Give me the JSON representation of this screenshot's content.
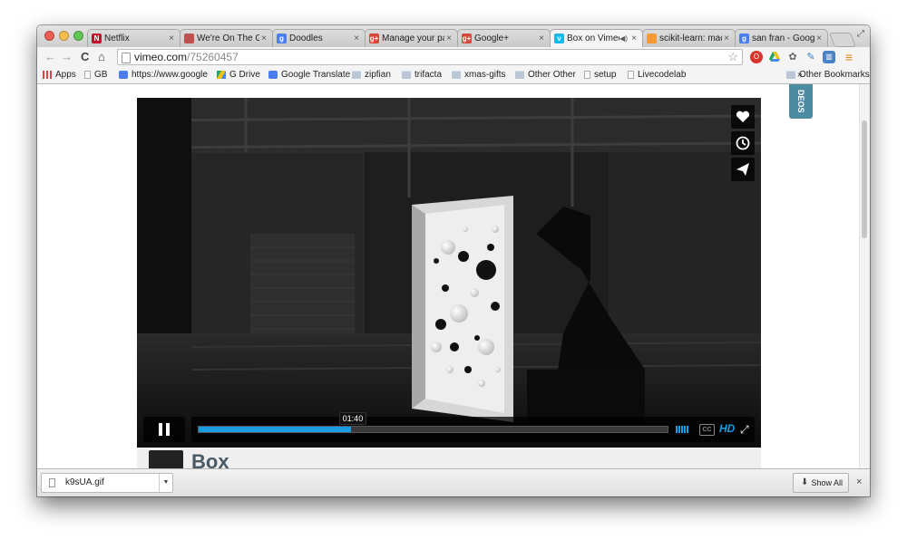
{
  "browser": {
    "tabs": [
      {
        "title": "Netflix",
        "favicon": "netflix-favicon-icon",
        "favicon_color": "#c8102e",
        "favicon_text": "N",
        "close": "×"
      },
      {
        "title": "We're On The Go",
        "favicon": "phone-favicon-icon",
        "favicon_color": "#c05050",
        "favicon_text": "",
        "close": "×"
      },
      {
        "title": "Doodles",
        "favicon": "google-favicon-icon",
        "favicon_color": "#4a7ef0",
        "favicon_text": "g",
        "close": "×"
      },
      {
        "title": "Manage your pag",
        "favicon": "google-plus-favicon-icon",
        "favicon_color": "#d34836",
        "favicon_text": "g+",
        "close": "×"
      },
      {
        "title": "Google+",
        "favicon": "google-plus-favicon-icon",
        "favicon_color": "#d34836",
        "favicon_text": "g+",
        "close": "×"
      },
      {
        "title": "Box on Vimeo",
        "favicon": "vimeo-favicon-icon",
        "favicon_color": "#1ab7ea",
        "favicon_text": "v",
        "close": "×",
        "active": true,
        "audio": "◀)"
      },
      {
        "title": "scikit-learn: mac",
        "favicon": "scikit-favicon-icon",
        "favicon_color": "#f89939",
        "favicon_text": "",
        "close": "×"
      },
      {
        "title": "san fran - Googl",
        "favicon": "google-favicon-icon",
        "favicon_color": "#4a7ef0",
        "favicon_text": "g",
        "close": "×"
      }
    ],
    "url": {
      "host": "vimeo.com",
      "path": "/75260457"
    },
    "nav": {
      "back": "←",
      "forward": "→",
      "reload": "C",
      "home": "⌂",
      "star": "☆",
      "menu": "≡"
    },
    "bookmarks": [
      {
        "label": "Apps",
        "icon": "apps-grid-icon"
      },
      {
        "label": "GB",
        "icon": "page-icon"
      },
      {
        "label": "https://www.google",
        "icon": "google-icon"
      },
      {
        "label": "G Drive",
        "icon": "drive-icon"
      },
      {
        "label": "Google Translate",
        "icon": "translate-icon"
      },
      {
        "label": "zipfian",
        "icon": "folder-icon"
      },
      {
        "label": "trifacta",
        "icon": "folder-icon"
      },
      {
        "label": "xmas-gifts",
        "icon": "folder-icon"
      },
      {
        "label": "Other Other",
        "icon": "folder-icon"
      },
      {
        "label": "setup",
        "icon": "page-icon"
      },
      {
        "label": "Livecodelab",
        "icon": "page-icon"
      }
    ],
    "bookmarks_overflow": "»",
    "other_bookmarks": "Other Bookmarks"
  },
  "page": {
    "videos_tab": "DEOS",
    "title_peek": "Box",
    "player": {
      "time_tooltip": "01:40",
      "progress": 0.325,
      "cc_label": "CC",
      "hd_label": "HD",
      "fullscreen": "⤢",
      "side_actions": [
        "like-heart-icon",
        "watch-later-clock-icon",
        "share-paper-plane-icon"
      ]
    }
  },
  "downloads": {
    "file": "k9sUA.gif",
    "arrow": "▼",
    "show_all": "Show All",
    "show_all_icon": "⬇",
    "close": "×"
  }
}
